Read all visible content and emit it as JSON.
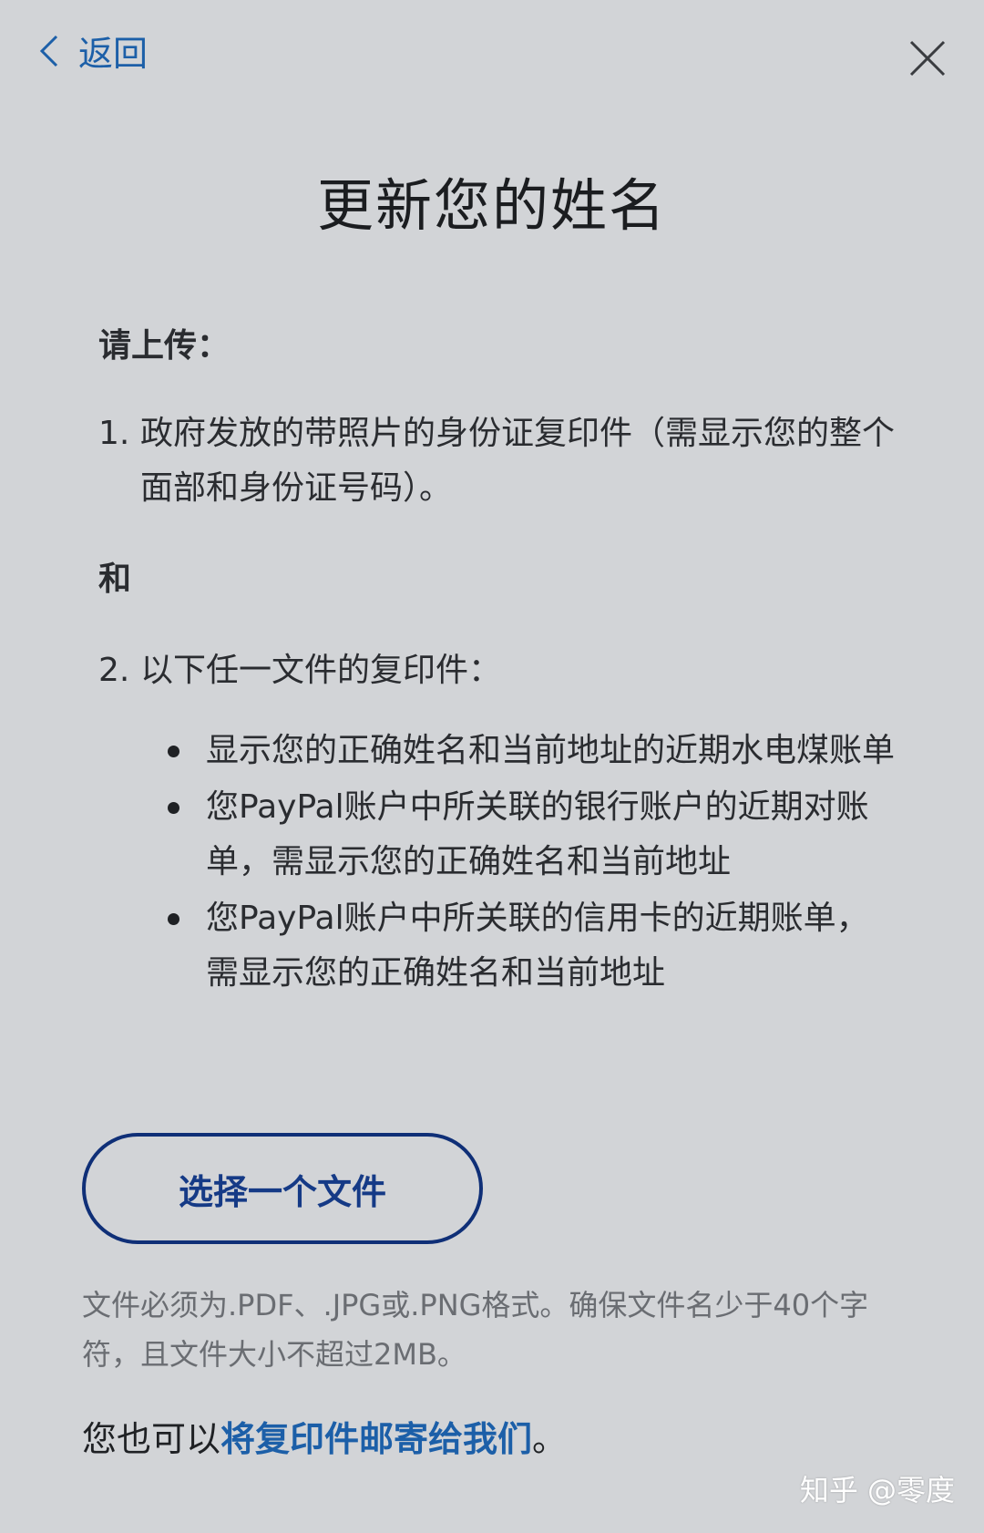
{
  "nav": {
    "back_label": "返回"
  },
  "page": {
    "title": "更新您的姓名"
  },
  "content": {
    "upload_heading": "请上传：",
    "item1_num": "1.",
    "item1_text": "政府发放的带照片的身份证复印件（需显示您的整个面部和身份证号码）。",
    "and_label": "和",
    "item2_num": "2.",
    "item2_text": "以下任一文件的复印件：",
    "bullets": [
      "显示您的正确姓名和当前地址的近期水电煤账单",
      "您PayPal账户中所关联的银行账户的近期对账单，需显示您的正确姓名和当前地址",
      "您PayPal账户中所关联的信用卡的近期账单，需显示您的正确姓名和当前地址"
    ]
  },
  "upload": {
    "button_label": "选择一个文件",
    "file_note": "文件必须为.PDF、.JPG或.PNG格式。确保文件名少于40个字符，且文件大小不超过2MB。"
  },
  "mail": {
    "prefix": "您也可以",
    "link_text": "将复印件邮寄给我们",
    "suffix": "。"
  },
  "watermark": {
    "text": "知乎 @零度"
  },
  "colors": {
    "background": "#d2d4d7",
    "link": "#1c5fa8",
    "button_border": "#0f2f77"
  }
}
